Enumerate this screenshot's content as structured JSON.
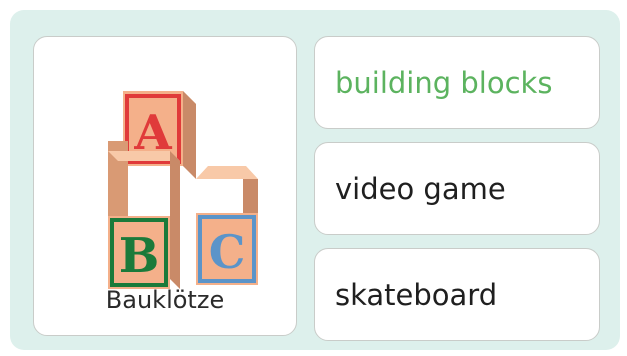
{
  "picture": {
    "label": "Bauklötze",
    "icon": "abc-blocks-icon",
    "block_letters": [
      "A",
      "B",
      "C"
    ]
  },
  "options": [
    {
      "label": "building blocks",
      "color": "#5cb35f"
    },
    {
      "label": "video game",
      "color": "#1f1f1f"
    },
    {
      "label": "skateboard",
      "color": "#1f1f1f"
    }
  ],
  "colors": {
    "panel": "#ddf0ec",
    "block_face": "#f4b08a",
    "block_side": "#c98a68",
    "block_top": "#f8c9a8",
    "letter_a": "#e03a3a",
    "letter_b": "#1b7a3a",
    "letter_c": "#5b94c9"
  }
}
